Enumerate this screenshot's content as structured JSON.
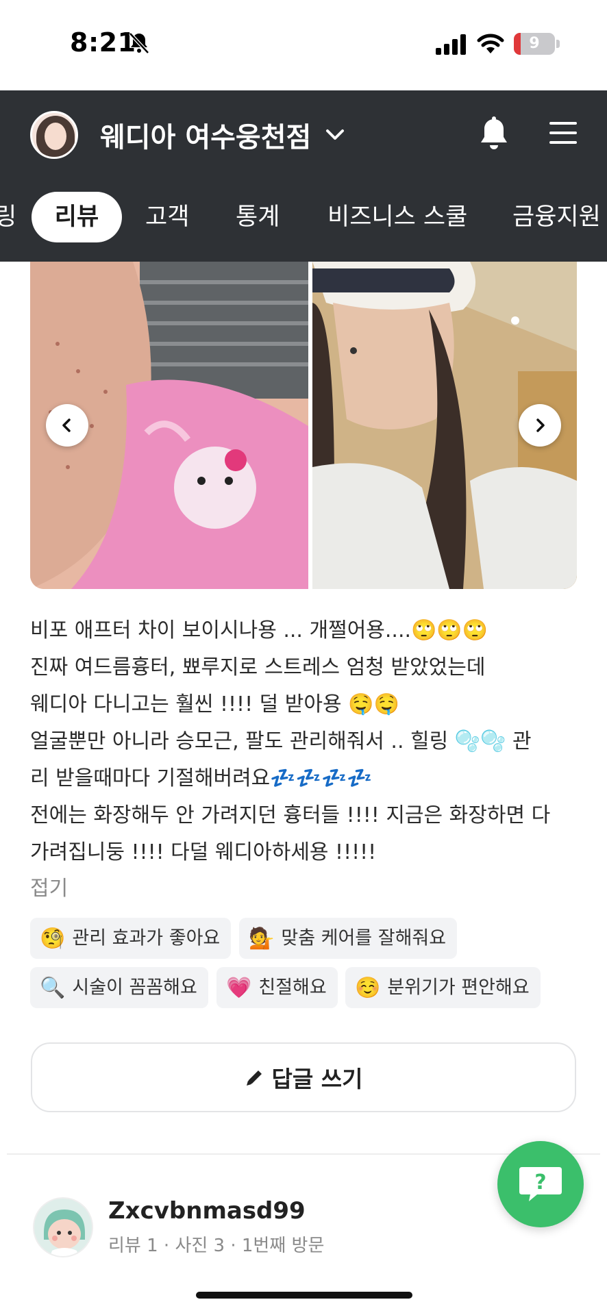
{
  "status_bar": {
    "time": "8:21",
    "battery": "9"
  },
  "header": {
    "store_name": "웨디아 여수웅천점",
    "tabs": [
      {
        "label": "링",
        "active": false
      },
      {
        "label": "리뷰",
        "active": true
      },
      {
        "label": "고객",
        "active": false
      },
      {
        "label": "통계",
        "active": false
      },
      {
        "label": "비즈니스 스쿨",
        "active": false
      },
      {
        "label": "금융지원",
        "active": false
      }
    ],
    "colors": {
      "bar_bg": "#2e3135",
      "active_tab_bg": "#ffffff"
    }
  },
  "review": {
    "lines": [
      "비포 애프터 차이 보이시나용 ... 개쩔어용....🙄🙄🙄",
      "진짜 여드름흉터, 뾰루지로 스트레스 엄청 받았었는데",
      "웨디아 다니고는 훨씬 !!!! 덜 받아용 🤤🤤",
      "얼굴뿐만 아니라 승모근, 팔도 관리해줘서 .. 힐링 🫧🫧 관",
      "리 받을때마다 기절해버려요💤💤💤💤",
      "전에는 화장해두 안 가려지던 흉터들 !!!! 지금은 화장하면 다",
      "가려집니둥 !!!! 다덜 웨디아하세용 !!!!!"
    ],
    "fold_label": "접기",
    "keywords": [
      {
        "icon": "🧐",
        "label": "관리 효과가 좋아요"
      },
      {
        "icon": "💁",
        "label": "맞춤 케어를 잘해줘요"
      },
      {
        "icon": "🔍",
        "label": "시술이 꼼꼼해요"
      },
      {
        "icon": "💗",
        "label": "친절해요"
      },
      {
        "icon": "☺️",
        "label": "분위기가 편안해요"
      }
    ],
    "reply_button_label": "답글 쓰기"
  },
  "next_review": {
    "username": "Zxcvbnmasd99",
    "meta": "리뷰 1 · 사진 3 · 1번째 방문"
  },
  "fab": {
    "icon": "question-chat-icon",
    "color": "#3bbf6b"
  }
}
